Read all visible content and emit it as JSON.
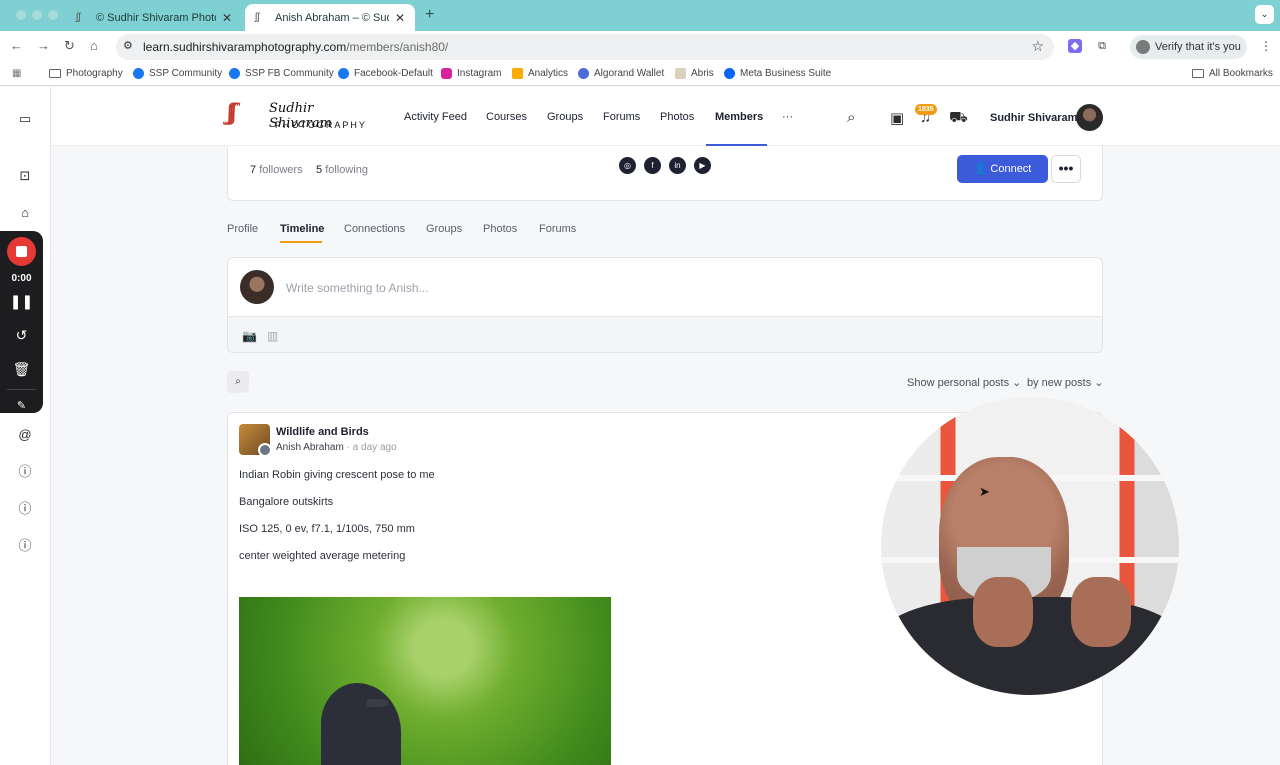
{
  "browser": {
    "tabs": [
      {
        "label": "© Sudhir Shivaram Photography"
      },
      {
        "label": "Anish Abraham – © Sudhir Shivaram Photography"
      }
    ],
    "new_tab": "+",
    "tab_menu": "⌄",
    "url_host": "learn.sudhirshivaramphotography.com",
    "url_path": "/members/anish80/",
    "verify": "Verify that it's you"
  },
  "bookmarks": [
    "Photography",
    "SSP Community",
    "SSP FB Community",
    "Facebook-Default",
    "Instagram",
    "Analytics",
    "Algorand Wallet",
    "Abris",
    "Meta Business Suite"
  ],
  "bookmarks_all": "All Bookmarks",
  "recorder": {
    "time": "0:00"
  },
  "site": {
    "logo_script": "Sudhir Shivaram",
    "logo_caps": "PHOTOGRAPHY",
    "nav": [
      "Activity Feed",
      "Courses",
      "Groups",
      "Forums",
      "Photos",
      "Members",
      "···"
    ],
    "active_nav": "Members",
    "notification_count": "1835",
    "user_name": "Sudhir Shivaram"
  },
  "profile": {
    "followers_count": "7",
    "followers_label": "followers",
    "following_count": "5",
    "following_label": "following",
    "connect_label": "Connect",
    "more_label": "•••"
  },
  "subtabs": [
    "Profile",
    "Timeline",
    "Connections",
    "Groups",
    "Photos",
    "Forums"
  ],
  "active_subtab": "Timeline",
  "composer": {
    "placeholder": "Write something to Anish..."
  },
  "filters": {
    "personal": "Show personal posts",
    "sort": "by new posts"
  },
  "post": {
    "group": "Wildlife and Birds",
    "author": "Anish Abraham",
    "time": "· a day ago",
    "lines": [
      "Indian Robin giving crescent pose to me",
      "Bangalore outskirts",
      "ISO 125, 0 ev, f7.1, 1/100s, 750 mm",
      "center weighted average metering"
    ]
  },
  "colors": {
    "accent": "#3b5bdb",
    "tab_underline": "#f39c12",
    "chrome": "#7fd0d2",
    "record": "#e53935"
  }
}
